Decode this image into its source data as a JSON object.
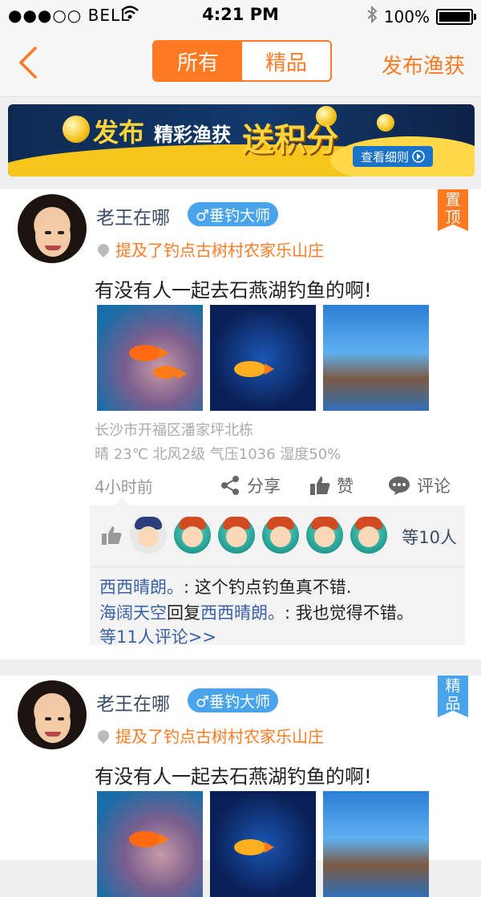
{
  "status_bar": {
    "carrier": "●●●○○ BELL",
    "wifi_icon": "wifi-icon",
    "time": "4:21 PM",
    "bluetooth_icon": "bluetooth-icon",
    "battery": "100%"
  },
  "nav": {
    "back_icon": "chevron-left-icon",
    "tabs": [
      {
        "label": "所有",
        "active": true
      },
      {
        "label": "精品",
        "active": false
      }
    ],
    "publish_label": "发布渔获",
    "accent_color": "#ff7a22"
  },
  "banner": {
    "word1": "发布",
    "word2": "精彩渔获",
    "word3": "送积分",
    "detail": "查看细则"
  },
  "posts": [
    {
      "user": "老王在哪",
      "badge": "♂垂钓大师",
      "location": "提及了钓点古树村农家乐山庄",
      "tag": "置顶",
      "content": "有没有人一起去石燕湖钓鱼的啊!",
      "address": "长沙市开福区潘家坪北栋",
      "weather": "晴 23℃ 北风2级 气压1036 湿度50%",
      "time_ago": "4小时前",
      "share": "分享",
      "like": "赞",
      "comment": "评论",
      "likes_count": "等10人",
      "comments": [
        {
          "name": "西西晴朗。",
          "text": ":  这个钓点钓鱼真不错."
        },
        {
          "name": "海阔天空",
          "reply": "回复",
          "target": "西西晴朗。",
          "text": ":  我也觉得不错。"
        }
      ],
      "more_comments": "等11人评论>>"
    },
    {
      "user": "老王在哪",
      "badge": "♂垂钓大师",
      "location": "提及了钓点古树村农家乐山庄",
      "tag": "精品",
      "content": "有没有人一起去石燕湖钓鱼的啊!"
    }
  ]
}
